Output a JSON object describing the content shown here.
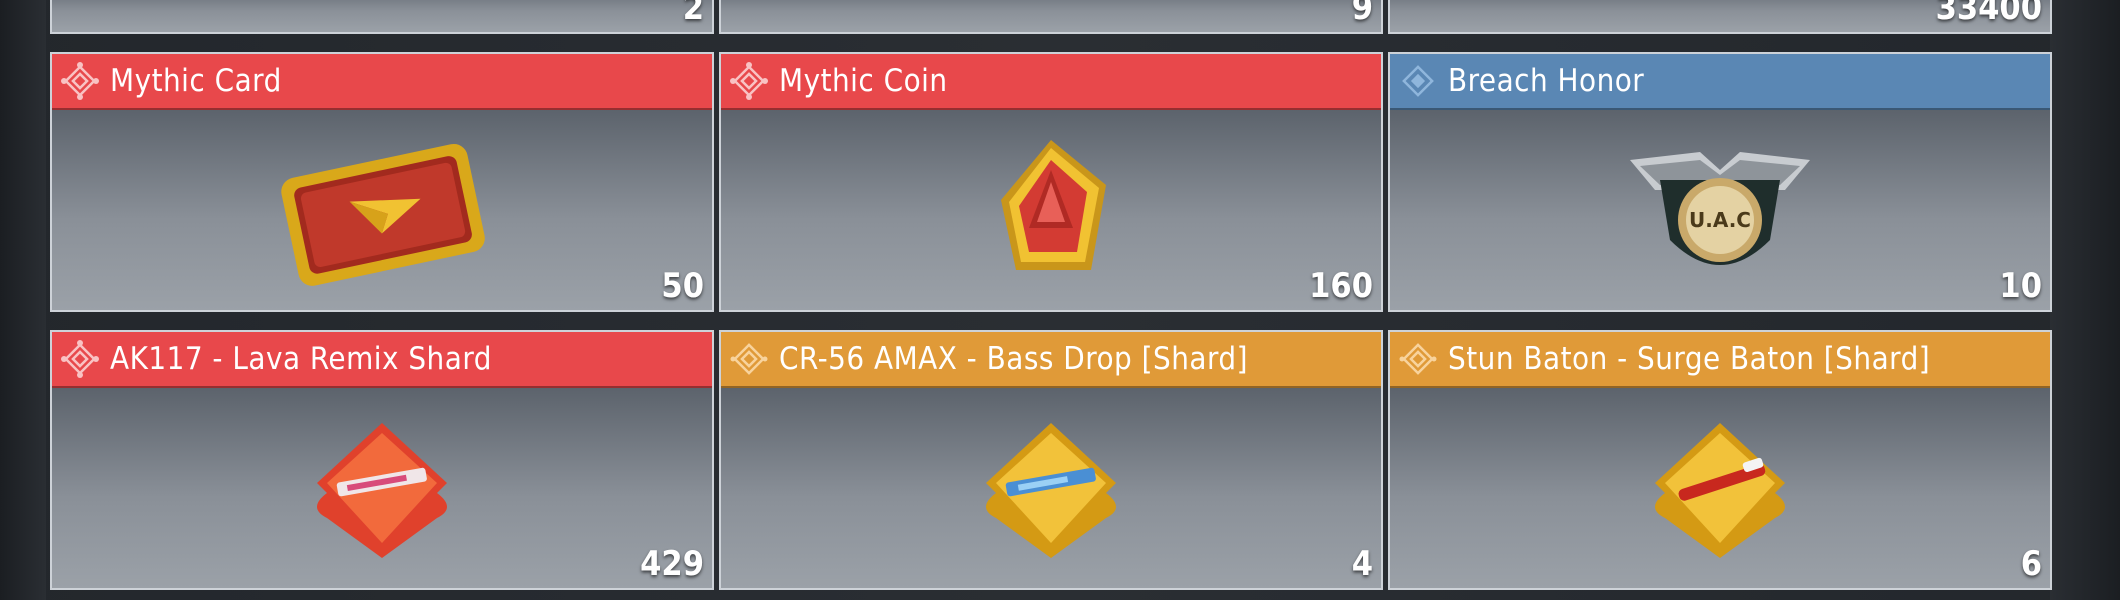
{
  "top_row": [
    {
      "qty": "2"
    },
    {
      "qty": "9"
    },
    {
      "qty": "33400"
    }
  ],
  "items": [
    {
      "name": "Mythic Card",
      "qty": "50",
      "rarity": "mythic",
      "color": "#e8484b",
      "icon": "card-icon"
    },
    {
      "name": "Mythic Coin",
      "qty": "160",
      "rarity": "mythic",
      "color": "#e8484b",
      "icon": "coin-icon"
    },
    {
      "name": "Breach Honor",
      "qty": "10",
      "rarity": "rare",
      "color": "#5a87b4",
      "icon": "badge-icon"
    },
    {
      "name": "AK117 - Lava Remix Shard",
      "qty": "429",
      "rarity": "mythic",
      "color": "#e8484b",
      "icon": "shard-icon"
    },
    {
      "name": "CR-56 AMAX - Bass Drop [Shard]",
      "qty": "4",
      "rarity": "legendary",
      "color": "#e09a38",
      "icon": "shard-icon"
    },
    {
      "name": "Stun Baton - Surge Baton [Shard]",
      "qty": "6",
      "rarity": "legendary",
      "color": "#e09a38",
      "icon": "shard-icon"
    }
  ],
  "badge_text": "U.A.C"
}
